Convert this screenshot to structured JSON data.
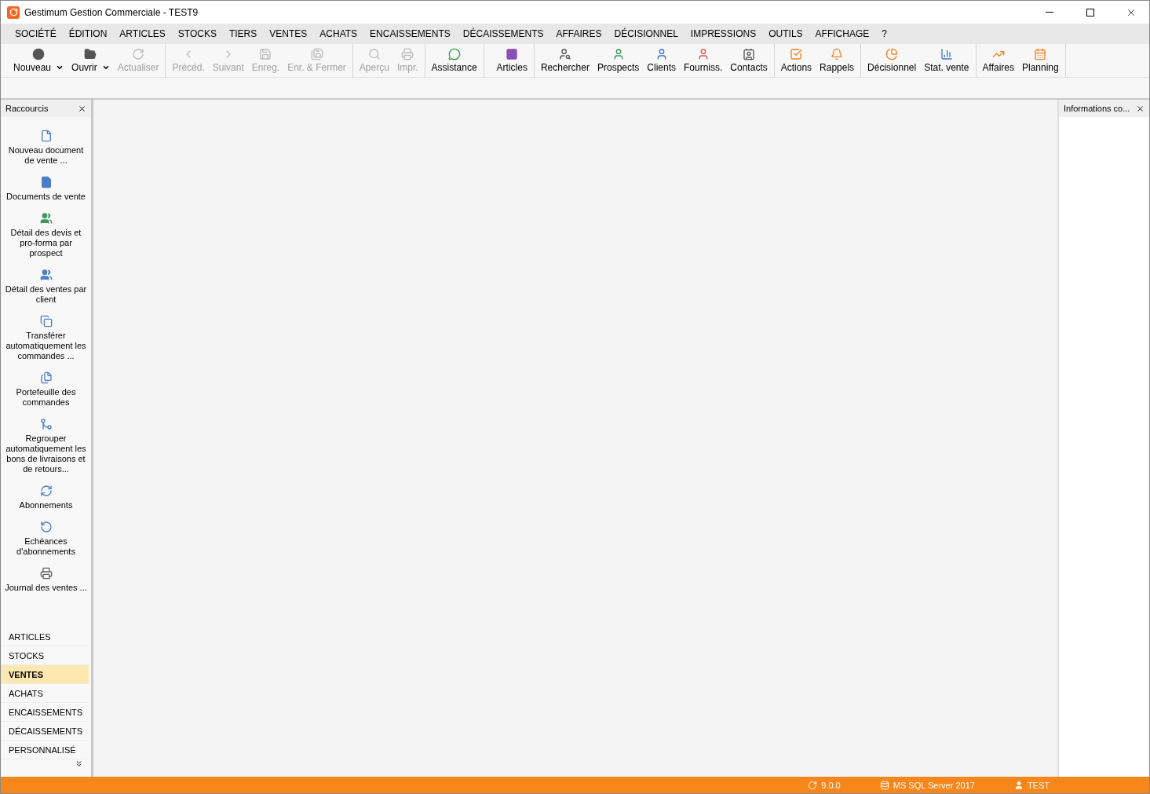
{
  "window": {
    "title": "Gestimum Gestion Commerciale - TEST9"
  },
  "menu": [
    "SOCIÉTÉ",
    "ÉDITION",
    "ARTICLES",
    "STOCKS",
    "TIERS",
    "VENTES",
    "ACHATS",
    "ENCAISSEMENTS",
    "DÉCAISSEMENTS",
    "AFFAIRES",
    "DÉCISIONNEL",
    "IMPRESSIONS",
    "OUTILS",
    "AFFICHAGE",
    "?"
  ],
  "toolbar_main": [
    [
      {
        "label": "Nouveau",
        "disabled": false,
        "dropdown": true
      },
      {
        "label": "Ouvrir",
        "disabled": false,
        "dropdown": true
      },
      {
        "label": "Actualiser",
        "disabled": true,
        "dropdown": false
      }
    ],
    [
      {
        "label": "Précéd.",
        "disabled": true,
        "dropdown": false
      },
      {
        "label": "Suivant",
        "disabled": true,
        "dropdown": false
      },
      {
        "label": "Enreg.",
        "disabled": true,
        "dropdown": false
      },
      {
        "label": "Enr. & Fermer",
        "disabled": true,
        "dropdown": false
      }
    ],
    [
      {
        "label": "Aperçu",
        "disabled": true,
        "dropdown": false
      },
      {
        "label": "Impr.",
        "disabled": true,
        "dropdown": false
      }
    ],
    [
      {
        "label": "Assistance",
        "disabled": false,
        "dropdown": false
      }
    ]
  ],
  "toolbar_modules": [
    [
      {
        "label": "Articles",
        "disabled": false,
        "dropdown": false
      }
    ],
    [
      {
        "label": "Rechercher",
        "disabled": false,
        "dropdown": false
      },
      {
        "label": "Prospects",
        "disabled": false,
        "dropdown": false
      },
      {
        "label": "Clients",
        "disabled": false,
        "dropdown": false
      },
      {
        "label": "Fourniss.",
        "disabled": false,
        "dropdown": false
      },
      {
        "label": "Contacts",
        "disabled": false,
        "dropdown": false
      }
    ],
    [
      {
        "label": "Actions",
        "disabled": false,
        "dropdown": false
      },
      {
        "label": "Rappels",
        "disabled": false,
        "dropdown": false
      }
    ],
    [
      {
        "label": "Décisionnel",
        "disabled": false,
        "dropdown": false
      },
      {
        "label": "Stat. vente",
        "disabled": false,
        "dropdown": false
      }
    ],
    [
      {
        "label": "Affaires",
        "disabled": false,
        "dropdown": false
      },
      {
        "label": "Planning",
        "disabled": false,
        "dropdown": false
      }
    ]
  ],
  "shortcuts_panel": {
    "title": "Raccourcis",
    "items": [
      "Nouveau document de vente ...",
      "Documents de vente",
      "Détail des devis et pro-forma par prospect",
      "Détail des ventes par client",
      "Transférer automatiquement les commandes ...",
      "Portefeuille des commandes",
      "Regrouper automatiquement les bons de livraisons et de retours...",
      "Abonnements",
      "Echéances d'abonnements",
      "Journal des ventes ..."
    ],
    "sections": [
      {
        "label": "ARTICLES",
        "selected": false
      },
      {
        "label": "STOCKS",
        "selected": false
      },
      {
        "label": "VENTES",
        "selected": true
      },
      {
        "label": "ACHATS",
        "selected": false
      },
      {
        "label": "ENCAISSEMENTS",
        "selected": false
      },
      {
        "label": "DÉCAISSEMENTS",
        "selected": false
      },
      {
        "label": "PERSONNALISÉ",
        "selected": false
      }
    ]
  },
  "info_panel": {
    "title": "Informations co..."
  },
  "status_bar": {
    "version": "9.0.0",
    "database": "MS SQL Server 2017",
    "user": "TEST"
  }
}
